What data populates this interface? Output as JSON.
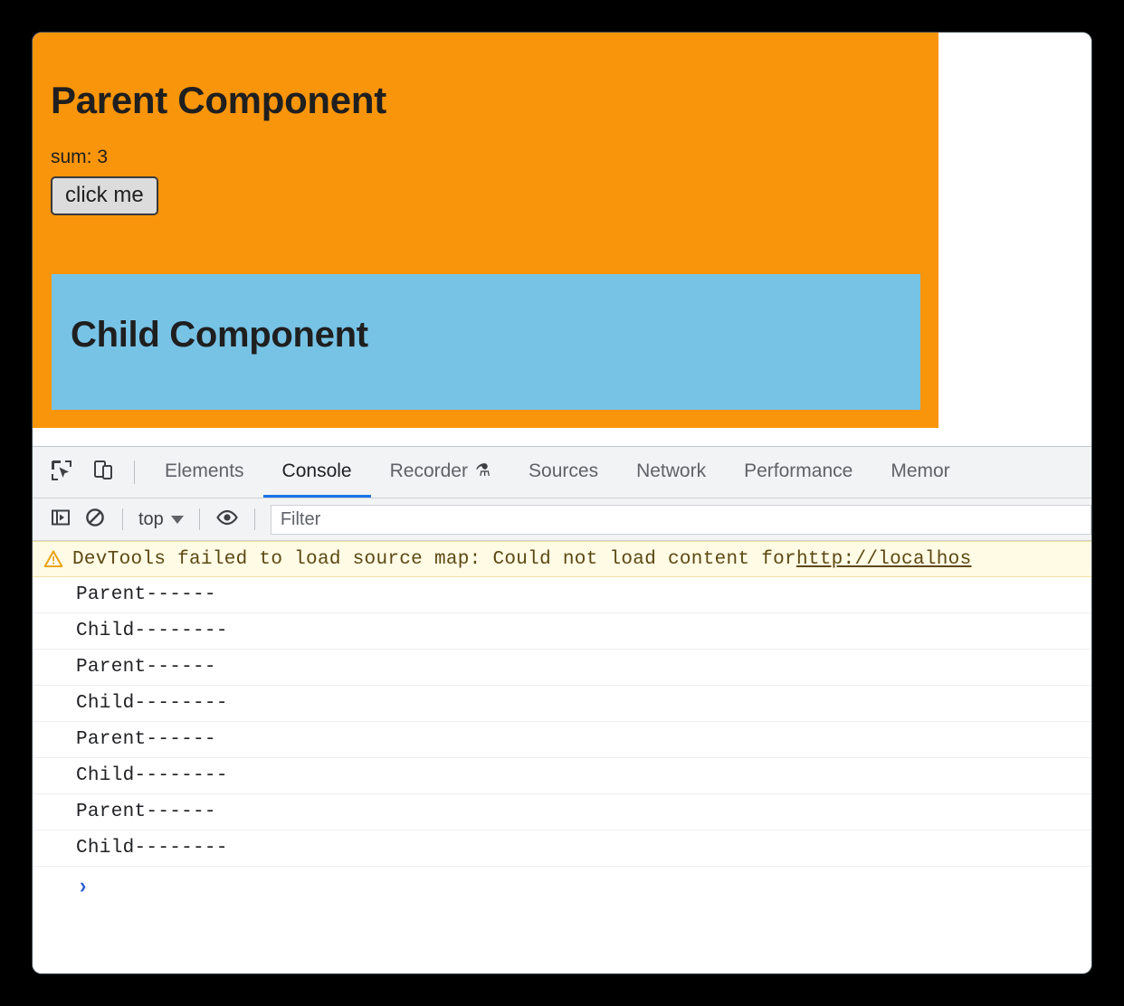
{
  "window": {
    "background_color": "#000000",
    "page_background": "#ffffff"
  },
  "page": {
    "parent": {
      "title": "Parent Component",
      "sum_label": "sum: 3",
      "button_label": "click me",
      "background_color": "#F9950B"
    },
    "child": {
      "title": "Child Component",
      "background_color": "#77C3E6"
    }
  },
  "devtools": {
    "toolbar_icons": {
      "inspect": "inspect-element-icon",
      "device": "device-toolbar-icon"
    },
    "tabs": [
      {
        "label": "Elements",
        "active": false
      },
      {
        "label": "Console",
        "active": true
      },
      {
        "label": "Recorder",
        "active": false,
        "badge": "⚗"
      },
      {
        "label": "Sources",
        "active": false
      },
      {
        "label": "Network",
        "active": false
      },
      {
        "label": "Performance",
        "active": false
      },
      {
        "label": "Memor",
        "active": false
      }
    ],
    "active_tab_accent": "#1a73e8",
    "console_toolbar": {
      "sidebar_toggle": "console-sidebar-icon",
      "clear_console": "clear-console-icon",
      "context": "top",
      "eye": "live-expression-icon",
      "filter_placeholder": "Filter",
      "filter_value": ""
    },
    "console": {
      "warning": {
        "icon": "warning-triangle-icon",
        "text": "DevTools failed to load source map: Could not load content for ",
        "link": "http://localhos",
        "background_color": "#fffbe5"
      },
      "messages": [
        "Parent------",
        "Child--------",
        "Parent------",
        "Child--------",
        "Parent------",
        "Child--------",
        "Parent------",
        "Child--------"
      ],
      "prompt": {
        "chevron": "›",
        "value": "",
        "color": "#2d5fd6"
      }
    }
  }
}
